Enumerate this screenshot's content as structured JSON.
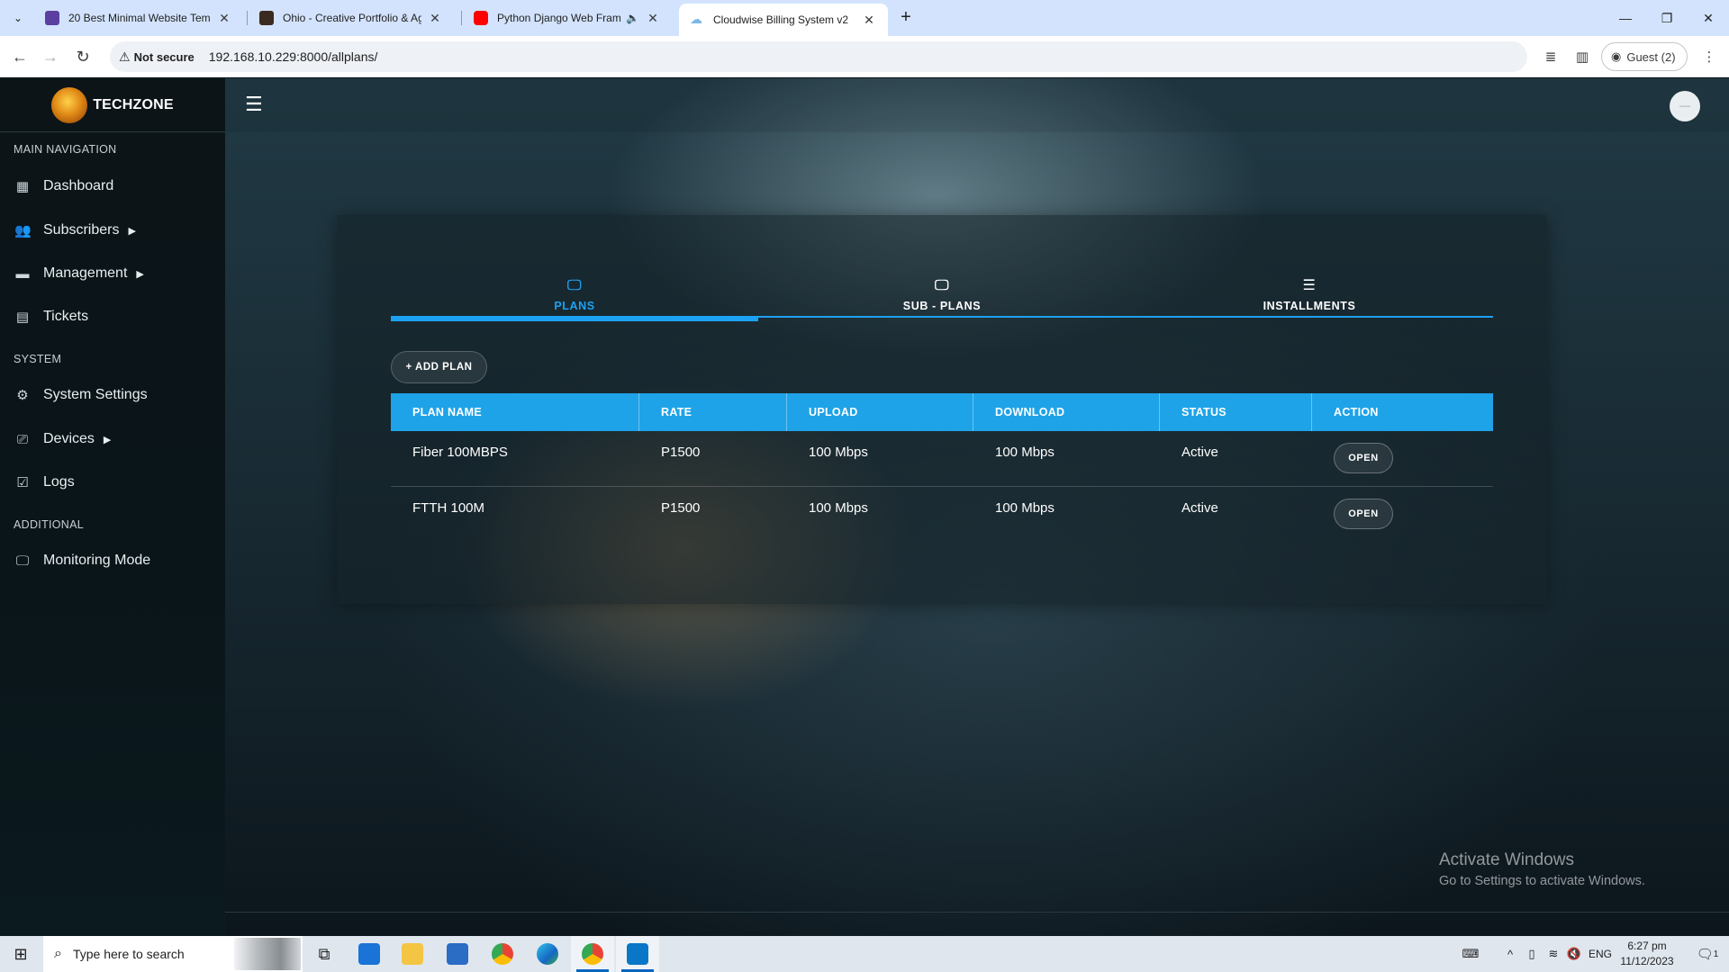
{
  "browser": {
    "tabs": [
      {
        "title": "20 Best Minimal Website Templ",
        "favicon_color": "#5b3fa0"
      },
      {
        "title": "Ohio - Creative Portfolio & Age",
        "favicon_color": "#3a2a20"
      },
      {
        "title": "Python Django Web Framew",
        "favicon_color": "#ff0000"
      },
      {
        "title": "Cloudwise Billing System v2",
        "favicon_color": "#7ab8e8"
      }
    ],
    "security_label": "Not secure",
    "url": "192.168.10.229:8000/allplans/",
    "profile_label": "Guest (2)"
  },
  "app": {
    "brand": "TECHZONE",
    "sections": {
      "main": "MAIN NAVIGATION",
      "system": "SYSTEM",
      "additional": "ADDITIONAL"
    },
    "nav": {
      "dashboard": "Dashboard",
      "subscribers": "Subscribers",
      "management": "Management",
      "tickets": "Tickets",
      "system_settings": "System Settings",
      "devices": "Devices",
      "logs": "Logs",
      "monitoring": "Monitoring Mode"
    },
    "page_tabs": {
      "plans": "PLANS",
      "subplans": "SUB - PLANS",
      "installments": "INSTALLMENTS"
    },
    "add_plan": "+ ADD PLAN",
    "table": {
      "headers": [
        "PLAN NAME",
        "RATE",
        "UPLOAD",
        "DOWNLOAD",
        "STATUS",
        "ACTION"
      ],
      "rows": [
        {
          "name": "Fiber 100MBPS",
          "rate": "P1500",
          "upload": "100 Mbps",
          "download": "100 Mbps",
          "status": "Active",
          "action": "OPEN"
        },
        {
          "name": "FTTH 100M",
          "rate": "P1500",
          "upload": "100 Mbps",
          "download": "100 Mbps",
          "status": "Active",
          "action": "OPEN"
        }
      ]
    },
    "accent_color": "#1da1f2"
  },
  "watermark": {
    "line1": "Activate Windows",
    "line2": "Go to Settings to activate Windows."
  },
  "taskbar": {
    "search_placeholder": "Type here to search",
    "language": "ENG",
    "time": "6:27 pm",
    "date": "11/12/2023",
    "notifications": "1"
  }
}
